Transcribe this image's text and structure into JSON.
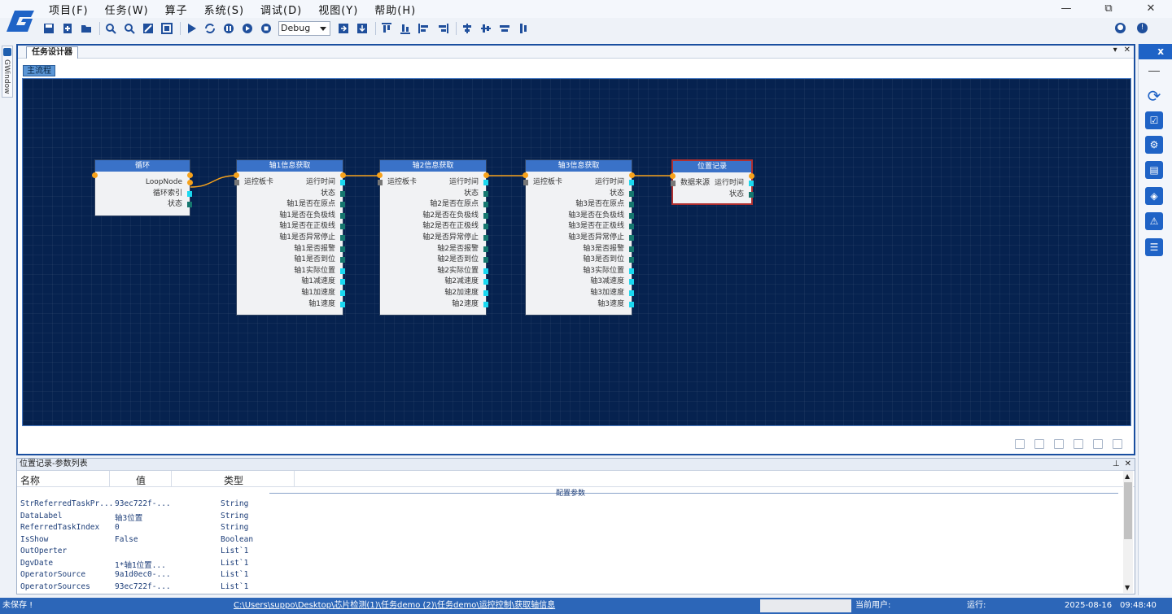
{
  "menu": [
    "项目(F)",
    "任务(W)",
    "算子",
    "系统(S)",
    "调试(D)",
    "视图(Y)",
    "帮助(H)"
  ],
  "window_controls": {
    "minimize": "—",
    "restore": "⧉",
    "close": "✕"
  },
  "toolbar": {
    "config": "Debug"
  },
  "side_tab": "GWindow",
  "designer": {
    "tab": "任务设计器",
    "subtab": "主流程",
    "nodes": [
      {
        "title": "循环",
        "rows": [
          "LoopNode",
          "循环索引",
          "状态"
        ]
      },
      {
        "title": "轴1信息获取",
        "input": "运控板卡",
        "rows": [
          "运行时间",
          "状态",
          "轴1是否在原点",
          "轴1是否在负极线",
          "轴1是否在正极线",
          "轴1是否异常停止",
          "轴1是否报警",
          "轴1是否到位",
          "轴1实际位置",
          "轴1减速度",
          "轴1加速度",
          "轴1速度"
        ]
      },
      {
        "title": "轴2信息获取",
        "input": "运控板卡",
        "rows": [
          "运行时间",
          "状态",
          "轴2是否在原点",
          "轴2是否在负极线",
          "轴2是否在正极线",
          "轴2是否异常停止",
          "轴2是否报警",
          "轴2是否到位",
          "轴2实际位置",
          "轴2减速度",
          "轴2加速度",
          "轴2速度"
        ]
      },
      {
        "title": "轴3信息获取",
        "input": "运控板卡",
        "rows": [
          "运行时间",
          "状态",
          "轴3是否在原点",
          "轴3是否在负极线",
          "轴3是否在正极线",
          "轴3是否异常停止",
          "轴3是否报警",
          "轴3是否到位",
          "轴3实际位置",
          "轴3减速度",
          "轴3加速度",
          "轴3速度"
        ]
      },
      {
        "title": "位置记录",
        "input": "数据来源",
        "rows": [
          "运行时间",
          "状态"
        ]
      }
    ]
  },
  "props": {
    "title": "位置记录-参数列表",
    "columns": [
      "名称",
      "值",
      "类型"
    ],
    "group": "配置参数",
    "rows": [
      [
        "StrReferredTaskPr...",
        "93ec722f-...",
        "String"
      ],
      [
        "DataLabel",
        "轴3位置",
        "String"
      ],
      [
        "ReferredTaskIndex",
        "0",
        "String"
      ],
      [
        "IsShow",
        "False",
        "Boolean"
      ],
      [
        "OutOperter",
        "",
        "List`1"
      ],
      [
        "DgvDate",
        "1*轴1位置...",
        "List`1"
      ],
      [
        "OperatorSource",
        "9a1d0ec0-...",
        "List`1"
      ],
      [
        "OperatorSources",
        "93ec722f-...",
        "List`1"
      ]
    ]
  },
  "status": {
    "unsaved": "未保存 !",
    "path": "C:\\Users\\suppo\\Desktop\\芯片检测(1)\\任务demo (2)\\任务demo\\运控控制\\获取轴信息",
    "user_label": "当前用户:",
    "run_label": "运行:",
    "date": "2025-08-16",
    "time": "09:48:40"
  },
  "colors": {
    "canvas": "#06224f",
    "node_header": "#3a72c8",
    "pin_cyan": "#1ad8f0",
    "pin_teal": "#16776f",
    "link": "#f7a21b",
    "accent": "#1f63c6"
  }
}
